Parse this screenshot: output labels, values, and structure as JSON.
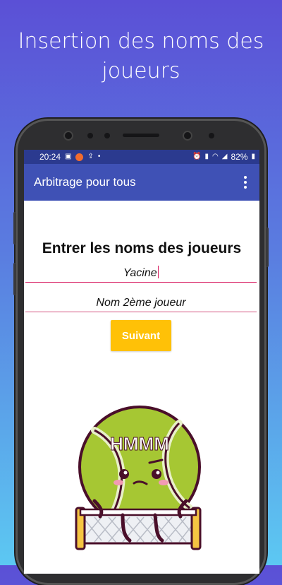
{
  "caption": "Insertion des noms des joueurs",
  "status_bar": {
    "time": "20:24",
    "battery": "82%"
  },
  "app_bar": {
    "title": "Arbitrage pour tous"
  },
  "form": {
    "heading": "Entrer les noms des joueurs",
    "player1_value": "Yacine",
    "player2_placeholder": "Nom 2ème joueur",
    "next_button": "Suivant"
  },
  "mascot": {
    "text": "HMMM"
  },
  "colors": {
    "primary": "#3f51b5",
    "status_bar": "#2b3a8f",
    "accent": "#d81b60",
    "button": "#ffc107",
    "ball": "#a6c733"
  }
}
